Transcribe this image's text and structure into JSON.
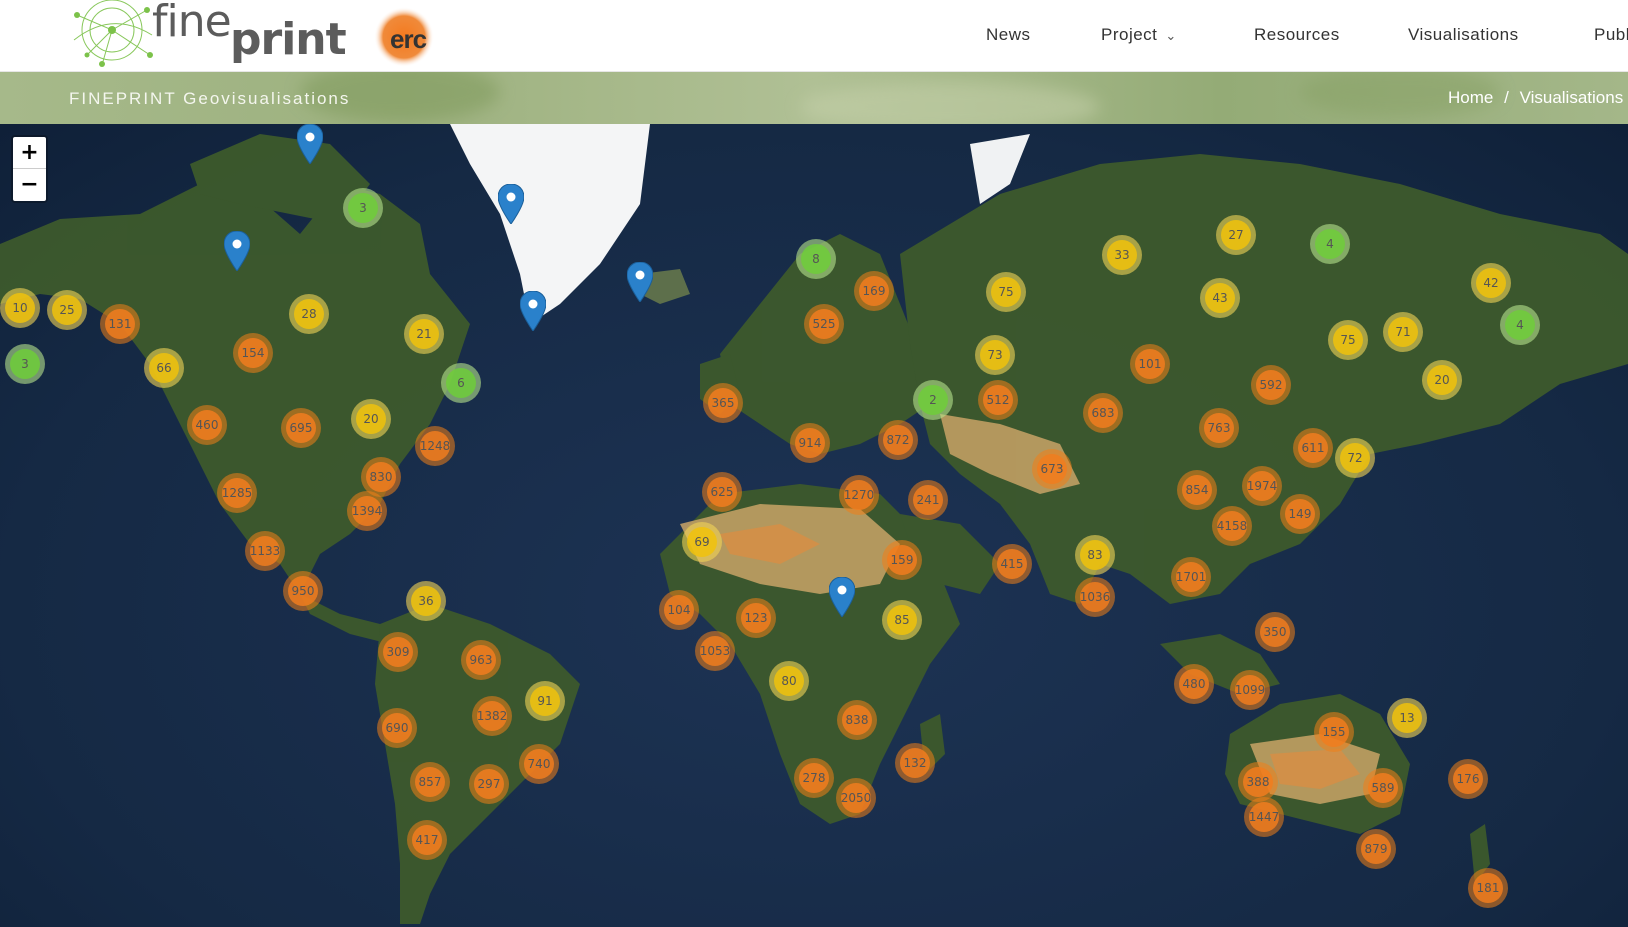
{
  "header": {
    "logo_fine": "fine",
    "logo_print": "print",
    "erc_logo": "erc",
    "nav": [
      {
        "label": "News"
      },
      {
        "label": "Project"
      },
      {
        "label": "Resources"
      },
      {
        "label": "Visualisations"
      },
      {
        "label": "Publ"
      }
    ]
  },
  "title_bar": {
    "title": "FINEPRINT Geovisualisations",
    "breadcrumb": [
      "Home",
      "/",
      "Visualisations",
      "/"
    ]
  },
  "map": {
    "zoom_in_label": "+",
    "zoom_out_label": "−",
    "clusters": [
      {
        "label": "3",
        "level": "small"
      },
      {
        "label": "10",
        "level": "medium"
      },
      {
        "label": "25",
        "level": "medium"
      },
      {
        "label": "131",
        "level": "large"
      },
      {
        "label": "3",
        "level": "small"
      },
      {
        "label": "66",
        "level": "medium"
      },
      {
        "label": "154",
        "level": "large"
      },
      {
        "label": "28",
        "level": "medium"
      },
      {
        "label": "21",
        "level": "medium"
      },
      {
        "label": "6",
        "level": "small"
      },
      {
        "label": "460",
        "level": "large"
      },
      {
        "label": "695",
        "level": "large"
      },
      {
        "label": "20",
        "level": "medium"
      },
      {
        "label": "1248",
        "level": "large"
      },
      {
        "label": "830",
        "level": "large"
      },
      {
        "label": "1285",
        "level": "large"
      },
      {
        "label": "1394",
        "level": "large"
      },
      {
        "label": "1133",
        "level": "large"
      },
      {
        "label": "950",
        "level": "large"
      },
      {
        "label": "36",
        "level": "medium"
      },
      {
        "label": "309",
        "level": "large"
      },
      {
        "label": "963",
        "level": "large"
      },
      {
        "label": "91",
        "level": "medium"
      },
      {
        "label": "1382",
        "level": "large"
      },
      {
        "label": "690",
        "level": "large"
      },
      {
        "label": "740",
        "level": "large"
      },
      {
        "label": "857",
        "level": "large"
      },
      {
        "label": "297",
        "level": "large"
      },
      {
        "label": "417",
        "level": "large"
      },
      {
        "label": "8",
        "level": "small"
      },
      {
        "label": "169",
        "level": "large"
      },
      {
        "label": "525",
        "level": "large"
      },
      {
        "label": "75",
        "level": "medium"
      },
      {
        "label": "33",
        "level": "medium"
      },
      {
        "label": "27",
        "level": "medium"
      },
      {
        "label": "4",
        "level": "small"
      },
      {
        "label": "42",
        "level": "medium"
      },
      {
        "label": "43",
        "level": "medium"
      },
      {
        "label": "4",
        "level": "small"
      },
      {
        "label": "75",
        "level": "medium"
      },
      {
        "label": "71",
        "level": "medium"
      },
      {
        "label": "73",
        "level": "medium"
      },
      {
        "label": "101",
        "level": "large"
      },
      {
        "label": "20",
        "level": "medium"
      },
      {
        "label": "365",
        "level": "large"
      },
      {
        "label": "2",
        "level": "small"
      },
      {
        "label": "512",
        "level": "large"
      },
      {
        "label": "683",
        "level": "large"
      },
      {
        "label": "592",
        "level": "large"
      },
      {
        "label": "914",
        "level": "large"
      },
      {
        "label": "872",
        "level": "large"
      },
      {
        "label": "763",
        "level": "large"
      },
      {
        "label": "611",
        "level": "large"
      },
      {
        "label": "72",
        "level": "medium"
      },
      {
        "label": "673",
        "level": "large"
      },
      {
        "label": "625",
        "level": "large"
      },
      {
        "label": "1270",
        "level": "large"
      },
      {
        "label": "241",
        "level": "large"
      },
      {
        "label": "854",
        "level": "large"
      },
      {
        "label": "1974",
        "level": "large"
      },
      {
        "label": "4158",
        "level": "large"
      },
      {
        "label": "149",
        "level": "large"
      },
      {
        "label": "69",
        "level": "medium"
      },
      {
        "label": "159",
        "level": "large"
      },
      {
        "label": "415",
        "level": "large"
      },
      {
        "label": "83",
        "level": "medium"
      },
      {
        "label": "1701",
        "level": "large"
      },
      {
        "label": "1036",
        "level": "large"
      },
      {
        "label": "104",
        "level": "large"
      },
      {
        "label": "123",
        "level": "large"
      },
      {
        "label": "85",
        "level": "medium"
      },
      {
        "label": "1053",
        "level": "large"
      },
      {
        "label": "350",
        "level": "large"
      },
      {
        "label": "80",
        "level": "medium"
      },
      {
        "label": "480",
        "level": "large"
      },
      {
        "label": "1099",
        "level": "large"
      },
      {
        "label": "838",
        "level": "large"
      },
      {
        "label": "155",
        "level": "large"
      },
      {
        "label": "13",
        "level": "medium"
      },
      {
        "label": "132",
        "level": "large"
      },
      {
        "label": "278",
        "level": "large"
      },
      {
        "label": "2050",
        "level": "large"
      },
      {
        "label": "388",
        "level": "large"
      },
      {
        "label": "589",
        "level": "large"
      },
      {
        "label": "176",
        "level": "large"
      },
      {
        "label": "1447",
        "level": "large"
      },
      {
        "label": "879",
        "level": "large"
      },
      {
        "label": "181",
        "level": "large"
      }
    ]
  },
  "colors": {
    "cluster_large": "#f07c1e",
    "cluster_medium": "#f0c20c",
    "cluster_small": "#6ecc39",
    "marker": "#2a81cb",
    "title_bar": "#a6b98a"
  }
}
